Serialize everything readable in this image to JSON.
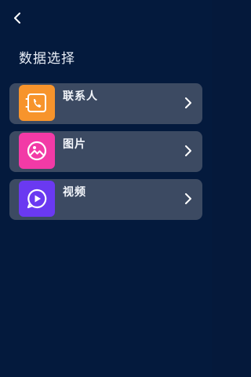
{
  "header": {
    "title": "数据选择",
    "back_icon": "chevron-left-icon"
  },
  "items": [
    {
      "label": "联系人",
      "icon": "contacts-icon",
      "color": "#f7942c"
    },
    {
      "label": "图片",
      "icon": "gallery-icon",
      "color": "#f23aa6"
    },
    {
      "label": "视频",
      "icon": "video-play-icon",
      "color": "#6a39f1"
    }
  ],
  "colors": {
    "background": "#041a3d",
    "card": "#3c4a62",
    "text": "#f2f5fa"
  }
}
